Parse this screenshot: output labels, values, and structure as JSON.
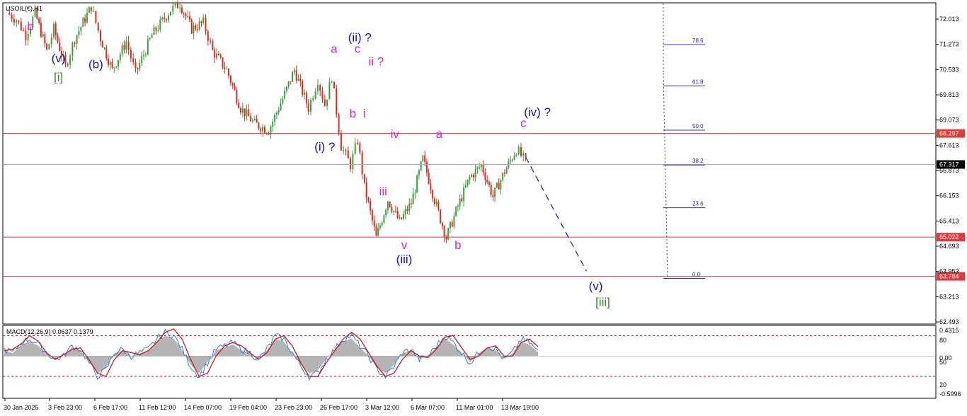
{
  "symbol_title": "USOIL(€),H1",
  "colors": {
    "bull": "#3aa23a",
    "bear": "#e0281c",
    "blue_label": "#1010c8",
    "magenta_label": "#e020e0",
    "green_label": "#2e8b22",
    "support_line": "#e03a3a",
    "fib_line": "#2b2bd6",
    "macd_signal": "#d01818",
    "macd_line": "#2a7de0",
    "macd_hist": "#b4b4b4"
  },
  "chart_data": [
    {
      "type": "candlestick",
      "title": "USOIL(€),H1",
      "xlabel": "",
      "ylabel": "",
      "ylim": [
        62.3,
        72.4
      ],
      "grid": false,
      "y_ticks": [
        "72.013",
        "71.273",
        "70.533",
        "69.813",
        "69.073",
        "67.613",
        "66.873",
        "66.153",
        "65.413",
        "64.693",
        "63.953",
        "63.213",
        "62.493"
      ],
      "x_ticks": [
        "30 Jan 2025",
        "3 Feb 23:00",
        "6 Feb 17:00",
        "11 Feb 12:00",
        "14 Feb 07:00",
        "19 Feb 04:00",
        "23 Feb 23:00",
        "26 Feb 17:00",
        "3 Mar 12:00",
        "6 Mar 07:00",
        "11 Mar 01:00",
        "13 Mar 19:00"
      ],
      "price_path": [
        {
          "x": 0,
          "y": 72.1
        },
        {
          "x": 4,
          "y": 71.9
        },
        {
          "x": 8,
          "y": 71.4
        },
        {
          "x": 12,
          "y": 72.1
        },
        {
          "x": 17,
          "y": 70.9
        },
        {
          "x": 20,
          "y": 71.6
        },
        {
          "x": 25,
          "y": 70.4
        },
        {
          "x": 29,
          "y": 71.3
        },
        {
          "x": 36,
          "y": 72.3
        },
        {
          "x": 40,
          "y": 71.3
        },
        {
          "x": 45,
          "y": 70.3
        },
        {
          "x": 51,
          "y": 71.2
        },
        {
          "x": 55,
          "y": 70.2
        },
        {
          "x": 62,
          "y": 71.4
        },
        {
          "x": 70,
          "y": 72.2
        },
        {
          "x": 74,
          "y": 72.4
        },
        {
          "x": 79,
          "y": 71.6
        },
        {
          "x": 84,
          "y": 71.8
        },
        {
          "x": 88,
          "y": 70.9
        },
        {
          "x": 94,
          "y": 70.3
        },
        {
          "x": 100,
          "y": 69.1
        },
        {
          "x": 106,
          "y": 68.6
        },
        {
          "x": 112,
          "y": 68.4
        },
        {
          "x": 118,
          "y": 69.4
        },
        {
          "x": 123,
          "y": 70.3
        },
        {
          "x": 129,
          "y": 69.1
        },
        {
          "x": 133,
          "y": 70.0
        },
        {
          "x": 136,
          "y": 69.2
        },
        {
          "x": 139,
          "y": 70.1
        },
        {
          "x": 143,
          "y": 67.9
        },
        {
          "x": 147,
          "y": 67.3
        },
        {
          "x": 150,
          "y": 68.1
        },
        {
          "x": 153,
          "y": 66.6
        },
        {
          "x": 158,
          "y": 65.0
        },
        {
          "x": 163,
          "y": 66.2
        },
        {
          "x": 168,
          "y": 65.5
        },
        {
          "x": 173,
          "y": 66.1
        },
        {
          "x": 178,
          "y": 67.5
        },
        {
          "x": 183,
          "y": 66.2
        },
        {
          "x": 188,
          "y": 65.0
        },
        {
          "x": 193,
          "y": 66.0
        },
        {
          "x": 198,
          "y": 66.9
        },
        {
          "x": 203,
          "y": 67.3
        },
        {
          "x": 208,
          "y": 66.3
        },
        {
          "x": 213,
          "y": 67.1
        },
        {
          "x": 218,
          "y": 67.8
        },
        {
          "x": 222,
          "y": 67.4
        }
      ],
      "x_axis_end": 300,
      "horizontal_levels": [
        {
          "price": 68.297,
          "label": "68.297",
          "color": "#e03a3a"
        },
        {
          "price": 65.022,
          "label": "65.022",
          "color": "#e03a3a"
        },
        {
          "price": 63.784,
          "label": "63.784",
          "color": "#e03a3a"
        },
        {
          "price": 67.317,
          "label": "67.317",
          "color": "#aaaaaa",
          "is_current": true
        }
      ],
      "fibonacci": {
        "levels": [
          {
            "label": "78.6",
            "price": 71.1
          },
          {
            "label": "61.8",
            "price": 69.8
          },
          {
            "label": "50.0",
            "price": 68.4
          },
          {
            "label": "38.2",
            "price": 67.3
          },
          {
            "label": "23.6",
            "price": 65.95
          },
          {
            "label": "0.0",
            "price": 63.72
          }
        ]
      },
      "projection": {
        "from": {
          "x": 222,
          "price": 67.55
        },
        "to": {
          "x": 248,
          "price": 63.95
        }
      },
      "wave_labels": [
        {
          "text": "b",
          "x": 10,
          "price": 71.55,
          "color": "magenta"
        },
        {
          "text": "(v)",
          "x": 22,
          "price": 70.55,
          "color": "blue"
        },
        {
          "text": "[i]",
          "x": 22,
          "price": 69.95,
          "color": "green"
        },
        {
          "text": "(b)",
          "x": 38,
          "price": 70.35,
          "color": "blue"
        },
        {
          "text": "(i) ?",
          "x": 136,
          "price": 67.75,
          "color": "blue"
        },
        {
          "text": "a",
          "x": 140,
          "price": 70.85,
          "color": "magenta"
        },
        {
          "text": "(ii) ?",
          "x": 151,
          "price": 71.2,
          "color": "blue"
        },
        {
          "text": "c",
          "x": 150,
          "price": 70.85,
          "color": "magenta"
        },
        {
          "text": "ii ?",
          "x": 158,
          "price": 70.45,
          "color": "magenta"
        },
        {
          "text": "b",
          "x": 148,
          "price": 68.8,
          "color": "magenta"
        },
        {
          "text": "i",
          "x": 153,
          "price": 68.8,
          "color": "magenta"
        },
        {
          "text": "iv",
          "x": 166,
          "price": 68.15,
          "color": "magenta"
        },
        {
          "text": "iii",
          "x": 161,
          "price": 66.35,
          "color": "magenta"
        },
        {
          "text": "v",
          "x": 170,
          "price": 64.65,
          "color": "magenta"
        },
        {
          "text": "(iii)",
          "x": 170,
          "price": 64.2,
          "color": "blue"
        },
        {
          "text": "a",
          "x": 185,
          "price": 68.15,
          "color": "magenta"
        },
        {
          "text": "b",
          "x": 193,
          "price": 64.65,
          "color": "magenta"
        },
        {
          "text": "c",
          "x": 221,
          "price": 68.5,
          "color": "magenta"
        },
        {
          "text": "(iv) ?",
          "x": 227,
          "price": 68.85,
          "color": "blue"
        },
        {
          "text": "(v)",
          "x": 252,
          "price": 63.35,
          "color": "blue"
        },
        {
          "text": "[iii]",
          "x": 255,
          "price": 62.85,
          "color": "green"
        }
      ]
    },
    {
      "type": "line",
      "title": "MACD(12,26,9) 0.0637 0.1379",
      "series": [
        {
          "name": "MACD",
          "values": [
            0.1,
            0.05,
            0.2,
            0.25,
            0.18,
            0.05,
            -0.05,
            0.0,
            0.15,
            0.1,
            -0.1,
            -0.3,
            -0.2,
            0.05,
            0.1,
            0.0,
            0.05,
            0.1,
            0.25,
            0.35,
            0.3,
            0.1,
            -0.15,
            -0.3,
            -0.1,
            0.1,
            0.15,
            0.2,
            0.1,
            0.05,
            -0.05,
            0.1,
            0.3,
            0.25,
            0.05,
            -0.15,
            -0.3,
            -0.25,
            -0.05,
            0.1,
            0.25,
            0.3,
            0.15,
            0.0,
            -0.2,
            -0.3,
            -0.15,
            0.05,
            0.1,
            -0.05,
            0.0,
            0.15,
            0.3,
            0.2,
            0.05,
            -0.1,
            0.05,
            0.15,
            0.1,
            -0.05,
            0.05,
            0.25,
            0.2,
            0.06
          ]
        },
        {
          "name": "Signal",
          "values": [
            0.08,
            0.1,
            0.18,
            0.3,
            0.22,
            0.05,
            -0.05,
            0.02,
            0.1,
            0.12,
            -0.05,
            -0.25,
            -0.3,
            -0.05,
            0.08,
            0.05,
            0.02,
            0.08,
            0.2,
            0.35,
            0.4,
            0.25,
            -0.05,
            -0.3,
            -0.25,
            0.0,
            0.15,
            0.2,
            0.15,
            0.05,
            -0.05,
            0.05,
            0.25,
            0.3,
            0.15,
            -0.1,
            -0.3,
            -0.3,
            -0.1,
            0.08,
            0.25,
            0.35,
            0.25,
            0.05,
            -0.15,
            -0.3,
            -0.25,
            -0.05,
            0.08,
            0.0,
            -0.02,
            0.1,
            0.28,
            0.3,
            0.12,
            -0.05,
            0.0,
            0.12,
            0.15,
            0.0,
            0.0,
            0.2,
            0.25,
            0.14
          ]
        }
      ],
      "y_ticks": [
        "0.4315",
        "80",
        "0.00",
        "50",
        "20",
        "-0.5996"
      ],
      "reference_levels": [
        0.3,
        -0.3
      ]
    }
  ]
}
